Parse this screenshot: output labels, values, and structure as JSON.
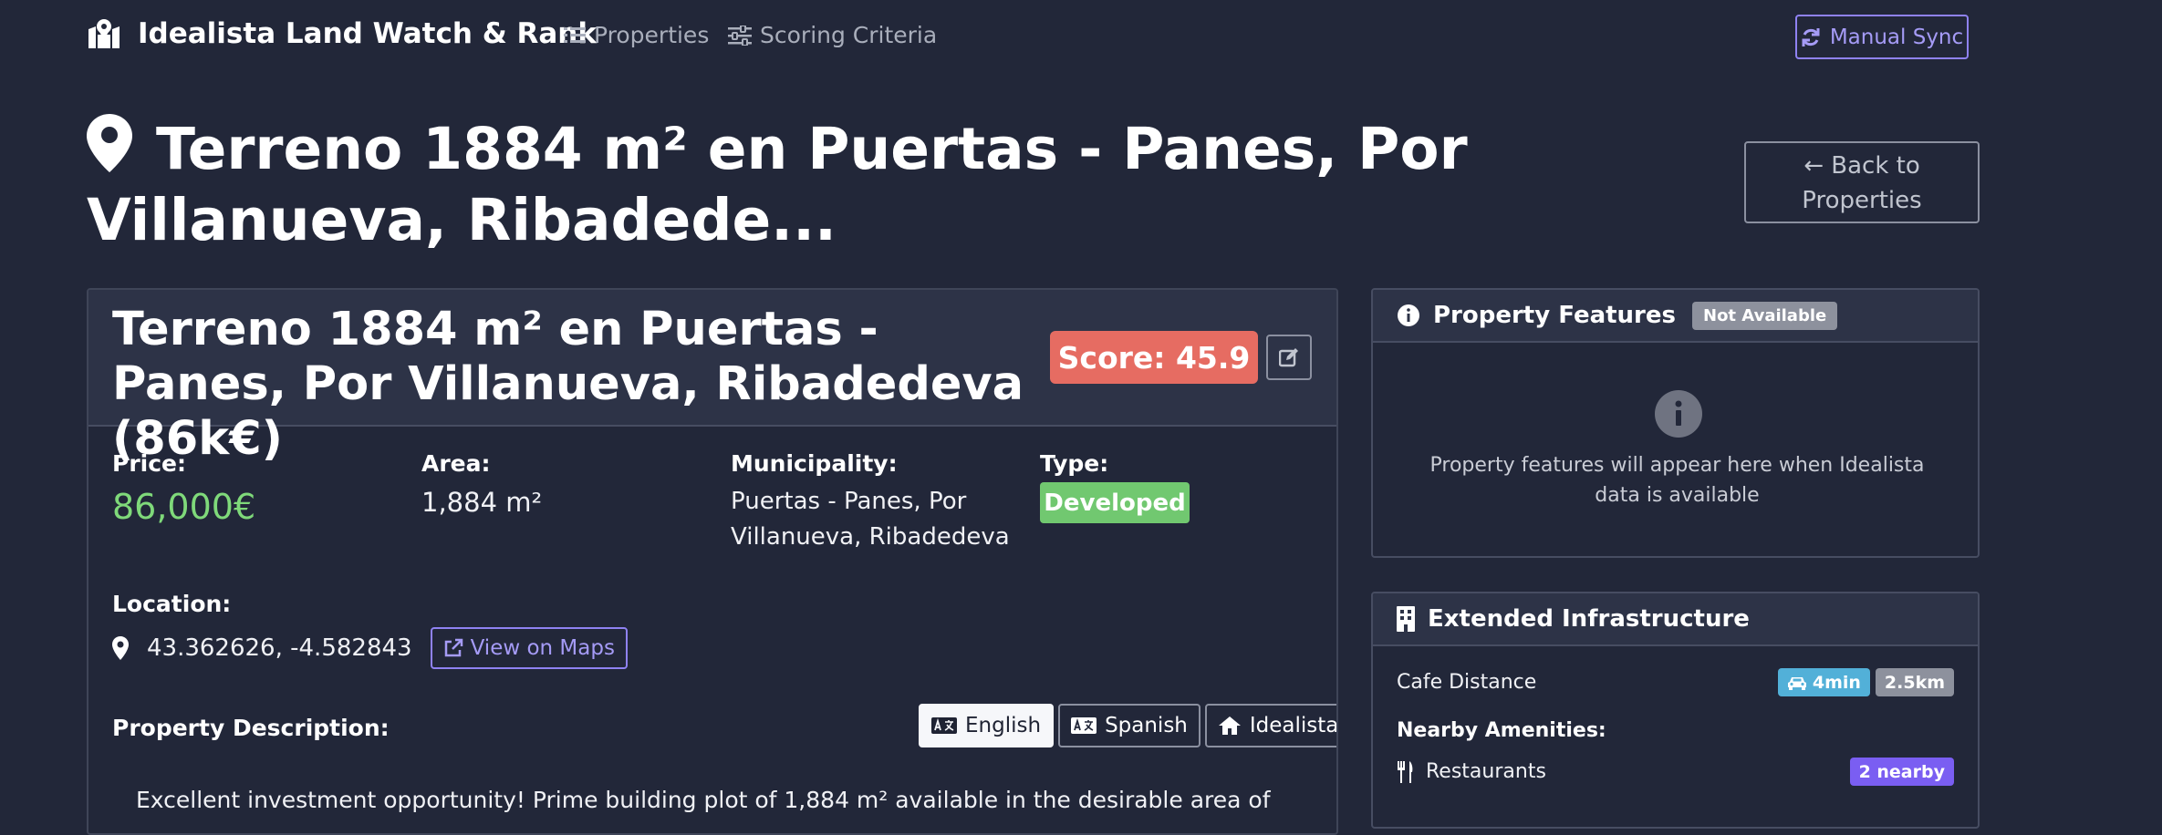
{
  "navbar": {
    "brand": "Idealista Land Watch & Rank",
    "links": [
      {
        "label": "Properties",
        "icon": "list-icon"
      },
      {
        "label": "Scoring Criteria",
        "icon": "sliders-icon"
      }
    ],
    "sync_button": "Manual Sync"
  },
  "page": {
    "title": "Terreno 1884 m² en Puertas - Panes, Por Villanueva, Ribadede...",
    "back_button": "← Back to Properties"
  },
  "property": {
    "title": "Terreno 1884 m² en Puertas - Panes, Por Villanueva, Ribadedeva (86k€)",
    "score_label": "Score: 45.9",
    "price_label": "Price:",
    "price": "86,000€",
    "area_label": "Area:",
    "area": "1,884 m²",
    "municipality_label": "Municipality:",
    "municipality": "Puertas - Panes, Por Villanueva, Ribadedeva",
    "type_label": "Type:",
    "type": "Developed",
    "location_label": "Location:",
    "coordinates": "43.362626, -4.582843",
    "maps_button": "View on Maps",
    "description_label": "Property Description:",
    "language_buttons": [
      {
        "label": "English",
        "active": true
      },
      {
        "label": "Spanish",
        "active": false
      },
      {
        "label": "Idealista",
        "active": false
      }
    ],
    "description": "Excellent investment opportunity! Prime building plot of 1,884 m² available in the desirable area of"
  },
  "features": {
    "title": "Property Features",
    "badge": "Not Available",
    "empty_message": "Property features will appear here when Idealista data is available"
  },
  "infrastructure": {
    "title": "Extended Infrastructure",
    "cafe_label": "Cafe Distance",
    "cafe_time": "4min",
    "cafe_distance": "2.5km",
    "amenities_label": "Nearby Amenities:",
    "restaurants_label": "Restaurants",
    "restaurants_count": "2 nearby"
  },
  "colors": {
    "background": "#222739",
    "accent": "#8f82f2",
    "score": "#e66c62",
    "price": "#7fd97a",
    "developed": "#71c870",
    "nearby": "#7a5ef2"
  }
}
